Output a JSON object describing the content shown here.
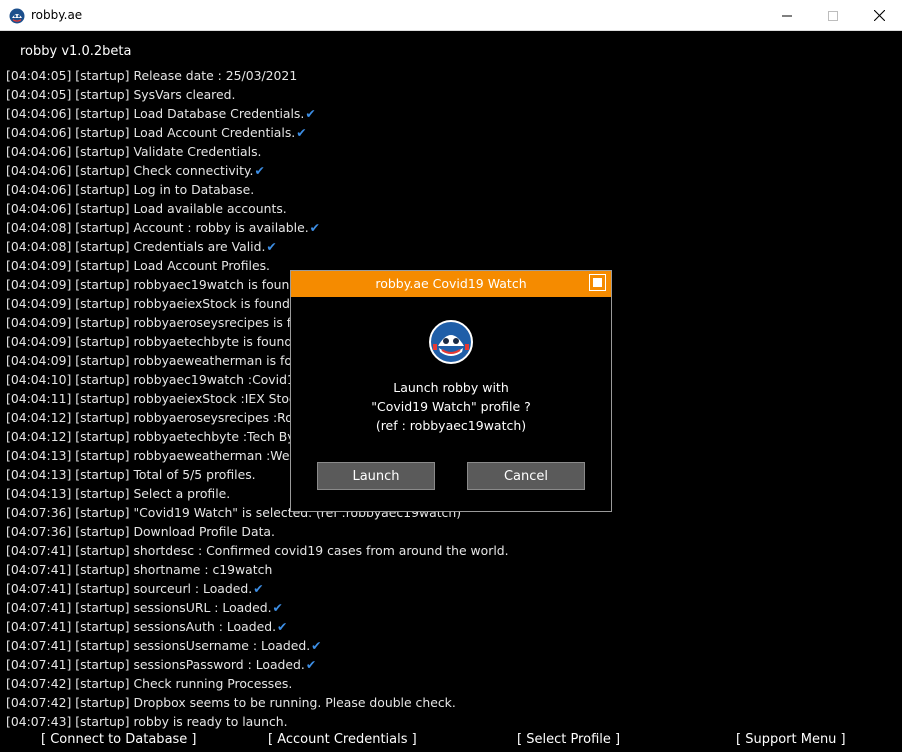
{
  "window": {
    "title": "robby.ae",
    "icon": "robby-logo-icon",
    "controls": [
      "minimize-icon",
      "maximize-icon",
      "close-icon"
    ]
  },
  "header": {
    "version": "robby v1.0.2beta"
  },
  "log": [
    {
      "text": "[04:04:05] [startup] Release date : 25/03/2021",
      "check": false
    },
    {
      "text": "[04:04:05] [startup] SysVars cleared.",
      "check": false
    },
    {
      "text": "[04:04:06] [startup] Load Database Credentials.",
      "check": true
    },
    {
      "text": "[04:04:06] [startup] Load Account Credentials.",
      "check": true
    },
    {
      "text": "[04:04:06] [startup] Validate Credentials.",
      "check": false
    },
    {
      "text": "[04:04:06] [startup] Check connectivity.",
      "check": true
    },
    {
      "text": "[04:04:06] [startup] Log in to Database.",
      "check": false
    },
    {
      "text": "[04:04:06] [startup] Load available accounts.",
      "check": false
    },
    {
      "text": "[04:04:08] [startup] Account : robby is available.",
      "check": true
    },
    {
      "text": "[04:04:08] [startup] Credentials are Valid.",
      "check": true
    },
    {
      "text": "[04:04:09] [startup] Load Account Profiles.",
      "check": false
    },
    {
      "text": "[04:04:09] [startup] robbyaec19watch is found.",
      "check": false
    },
    {
      "text": "[04:04:09] [startup] robbyaeiexStock is found.",
      "check": false
    },
    {
      "text": "[04:04:09] [startup] robbyaeroseysrecipes is fou",
      "check": false
    },
    {
      "text": "[04:04:09] [startup] robbyaetechbyte is found.",
      "check": false
    },
    {
      "text": "[04:04:09] [startup] robbyaeweatherman is fou",
      "check": false
    },
    {
      "text": "[04:04:10] [startup] robbyaec19watch :Covid19",
      "check": false
    },
    {
      "text": "[04:04:11] [startup] robbyaeiexStock :IEX Stock",
      "check": false
    },
    {
      "text": "[04:04:12] [startup] robbyaeroseysrecipes :Rose",
      "check": false
    },
    {
      "text": "[04:04:12] [startup] robbyaetechbyte :Tech Byt",
      "check": false
    },
    {
      "text": "[04:04:13] [startup] robbyaeweatherman :Weat",
      "check": false
    },
    {
      "text": "[04:04:13] [startup] Total of 5/5 profiles.",
      "check": false
    },
    {
      "text": "[04:04:13] [startup] Select a profile.",
      "check": false
    },
    {
      "text": "[04:07:36] [startup] \"Covid19 Watch\" is selected. (ref :robbyaec19watch)",
      "check": false
    },
    {
      "text": "[04:07:36] [startup] Download Profile Data.",
      "check": false
    },
    {
      "text": "[04:07:41] [startup] shortdesc : Confirmed covid19 cases from around the world.",
      "check": false
    },
    {
      "text": "[04:07:41] [startup] shortname : c19watch",
      "check": false
    },
    {
      "text": "[04:07:41] [startup] sourceurl : Loaded.",
      "check": true
    },
    {
      "text": "[04:07:41] [startup] sessionsURL : Loaded.",
      "check": true
    },
    {
      "text": "[04:07:41] [startup] sessionsAuth : Loaded.",
      "check": true
    },
    {
      "text": "[04:07:41] [startup] sessionsUsername : Loaded.",
      "check": true
    },
    {
      "text": "[04:07:41] [startup] sessionsPassword : Loaded.",
      "check": true
    },
    {
      "text": "[04:07:42] [startup] Check running Processes.",
      "check": false
    },
    {
      "text": "[04:07:42] [startup] Dropbox seems to be running. Please double check.",
      "check": false
    },
    {
      "text": "[04:07:43] [startup] robby is ready to launch.",
      "check": false
    }
  ],
  "check_mark": "✔",
  "bottom_menu": {
    "connect_db": "[ Connect to Database ]",
    "account_credentials": "[  Account Credentials ]",
    "select_profile": "[ Select Profile ]",
    "support_menu": "[ Support Menu ]"
  },
  "dialog": {
    "title": "robby.ae Covid19 Watch",
    "message_line1": "Launch robby with",
    "message_line2": "\"Covid19 Watch\" profile ?",
    "message_line3": "(ref : robbyaec19watch)",
    "launch_label": "Launch",
    "cancel_label": "Cancel",
    "header_color": "#f58b00"
  },
  "colors": {
    "background": "#000000",
    "log_text": "#e6e6e6",
    "check": "#3d8fe6",
    "accent": "#f58b00"
  }
}
